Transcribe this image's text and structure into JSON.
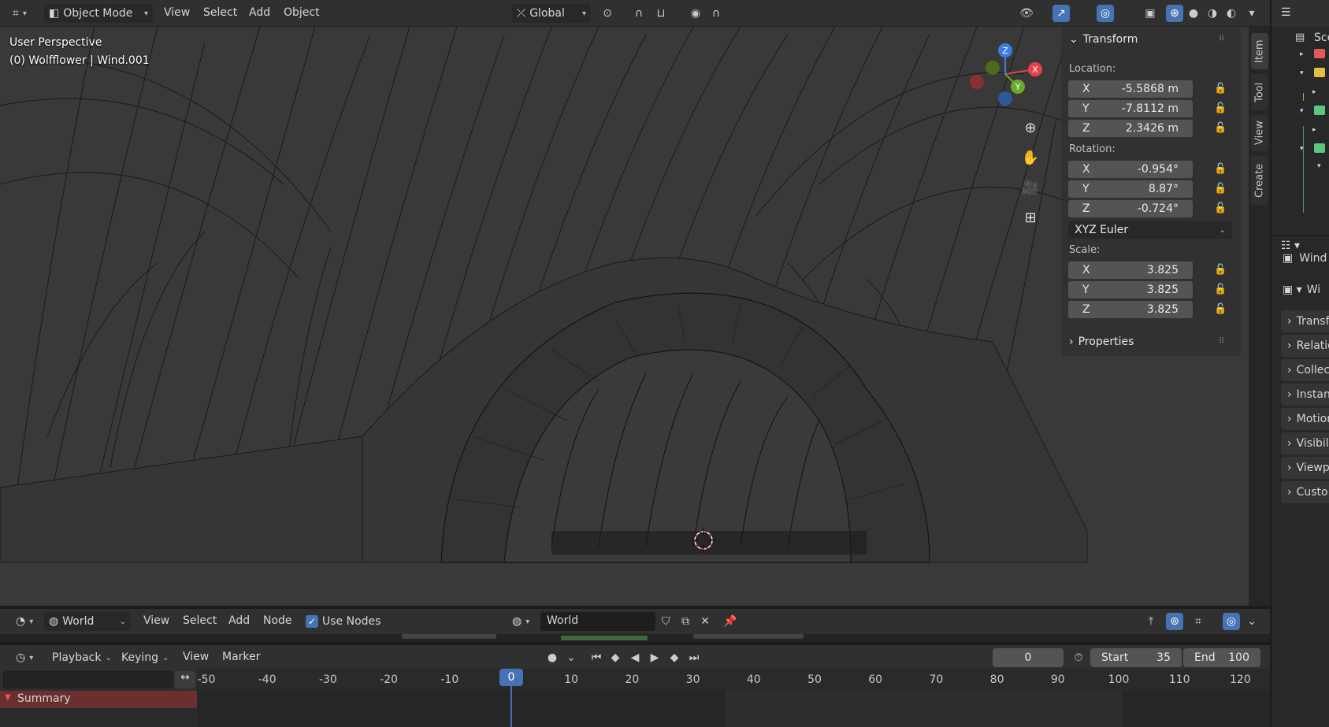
{
  "header": {
    "mode": "Object Mode",
    "menus": [
      "View",
      "Select",
      "Add",
      "Object"
    ],
    "orientation": "Global"
  },
  "viewport": {
    "perspective": "User Perspective",
    "object_info": "(0) Wolfflower | Wind.001",
    "gizmo": {
      "x": "X",
      "y": "Y",
      "z": "Z"
    }
  },
  "npanel": {
    "transform_title": "Transform",
    "location_label": "Location:",
    "location": [
      {
        "axis": "X",
        "value": "-5.5868 m"
      },
      {
        "axis": "Y",
        "value": "-7.8112 m"
      },
      {
        "axis": "Z",
        "value": "2.3426 m"
      }
    ],
    "rotation_label": "Rotation:",
    "rotation": [
      {
        "axis": "X",
        "value": "-0.954°"
      },
      {
        "axis": "Y",
        "value": "8.87°"
      },
      {
        "axis": "Z",
        "value": "-0.724°"
      }
    ],
    "rotation_mode": "XYZ Euler",
    "scale_label": "Scale:",
    "scale": [
      {
        "axis": "X",
        "value": "3.825"
      },
      {
        "axis": "Y",
        "value": "3.825"
      },
      {
        "axis": "Z",
        "value": "3.825"
      }
    ],
    "properties_title": "Properties"
  },
  "side_tabs": [
    "Item",
    "Tool",
    "View",
    "Create"
  ],
  "properties": {
    "object_name": "Wind",
    "object_select": "Wi",
    "sections": [
      "Transf",
      "Relatio",
      "Collec",
      "Instan",
      "Motion",
      "Visibili",
      "Viewp",
      "Custo"
    ]
  },
  "outliner": {
    "title": "Sce"
  },
  "node_editor": {
    "world_select": "World",
    "menus": [
      "View",
      "Select",
      "Add",
      "Node"
    ],
    "use_nodes_label": "Use Nodes",
    "use_nodes_checked": true,
    "world_field": "World"
  },
  "timeline": {
    "menus": [
      "Playback",
      "Keying",
      "View",
      "Marker"
    ],
    "current_frame": "0",
    "start_label": "Start",
    "start_value": "35",
    "end_label": "End",
    "end_value": "100",
    "ticks": [
      "-50",
      "-40",
      "-30",
      "-20",
      "-10",
      "0",
      "10",
      "20",
      "30",
      "40",
      "50",
      "60",
      "70",
      "80",
      "90",
      "100",
      "110",
      "120"
    ],
    "summary_label": "Summary"
  },
  "colors": {
    "accent": "#4772b3",
    "x_axis": "#e5414f",
    "y_axis": "#6ca82b",
    "z_axis": "#3d7ce0",
    "summary_bg": "#6b2f2f"
  }
}
